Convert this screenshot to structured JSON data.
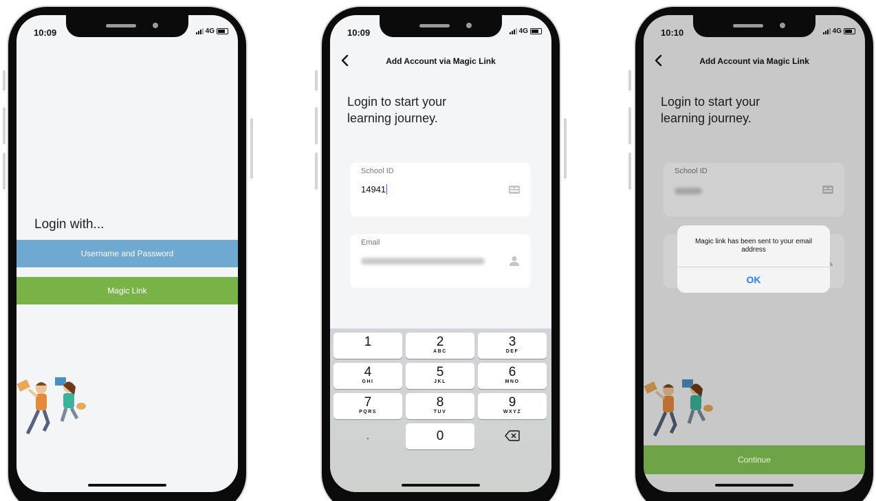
{
  "colors": {
    "screen_bg": "#f4f5f6",
    "username_button": "#6fa8d1",
    "magic_link_button": "#79b247",
    "continue_button": "#6fa348",
    "alert_ok": "#2b7cf4"
  },
  "phone1": {
    "status": {
      "time": "10:09",
      "network": "4G"
    },
    "login_with": "Login with...",
    "username_password_label": "Username and Password",
    "magic_link_label": "Magic Link",
    "illustration_icon": "jumping-students-illustration"
  },
  "phone2": {
    "status": {
      "time": "10:09",
      "network": "4G"
    },
    "nav_title": "Add Account via Magic Link",
    "heading_line1": "Login to start your",
    "heading_line2": "learning journey.",
    "school_id": {
      "label": "School ID",
      "value": "14941",
      "icon": "id-card-icon"
    },
    "email": {
      "label": "Email",
      "icon": "person-icon"
    },
    "keypad": [
      {
        "num": "1",
        "sub": ""
      },
      {
        "num": "2",
        "sub": "ABC"
      },
      {
        "num": "3",
        "sub": "DEF"
      },
      {
        "num": "4",
        "sub": "GHI"
      },
      {
        "num": "5",
        "sub": "JKL"
      },
      {
        "num": "6",
        "sub": "MNO"
      },
      {
        "num": "7",
        "sub": "PQRS"
      },
      {
        "num": "8",
        "sub": "TUV"
      },
      {
        "num": "9",
        "sub": "WXYZ"
      },
      {
        "num": ".",
        "sub": ""
      },
      {
        "num": "0",
        "sub": ""
      }
    ]
  },
  "phone3": {
    "status": {
      "time": "10:10",
      "network": "4G"
    },
    "nav_title": "Add Account via Magic Link",
    "heading_line1": "Login to start your",
    "heading_line2": "learning journey.",
    "school_id_label": "School ID",
    "alert": {
      "message": "Magic link has been sent to your email address",
      "ok": "OK"
    },
    "continue_label": "Continue"
  }
}
